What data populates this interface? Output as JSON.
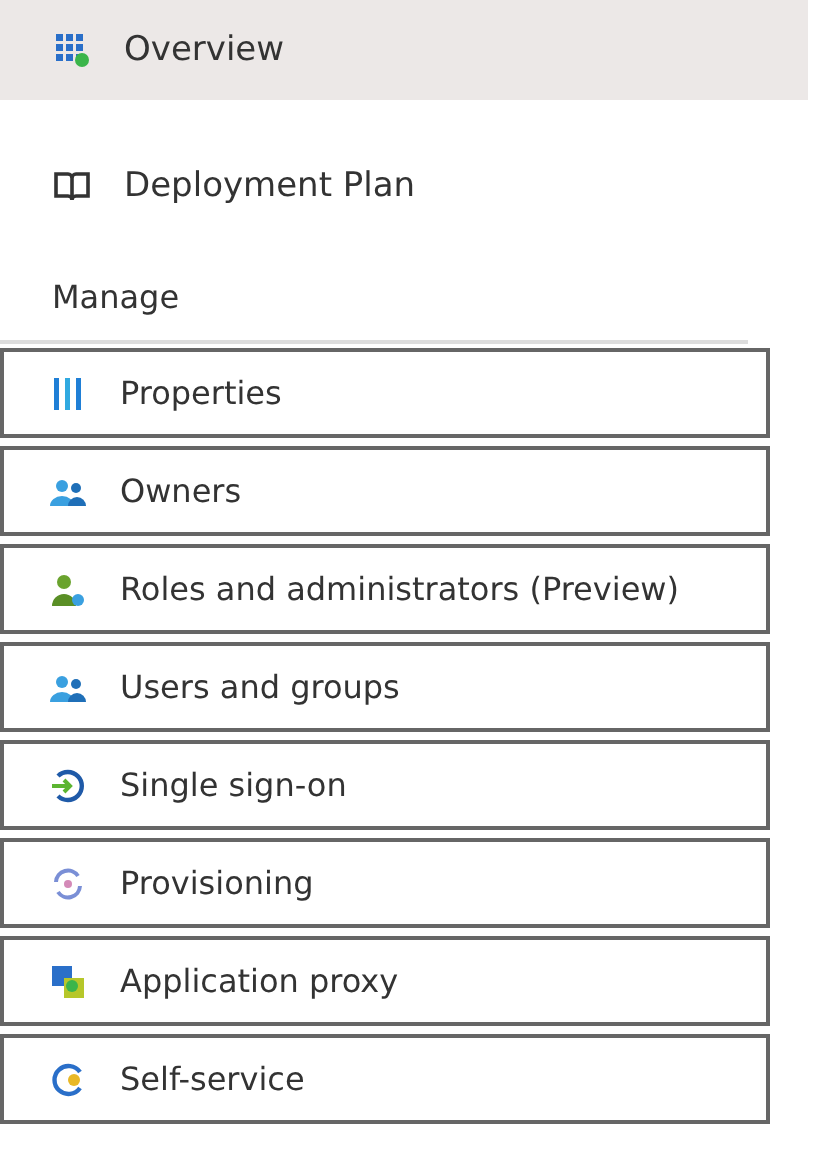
{
  "nav_items": [
    {
      "label": "Overview",
      "kind": "grid",
      "selected": true
    },
    {
      "label": "Deployment Plan",
      "kind": "book",
      "selected": false
    }
  ],
  "section": {
    "title": "Manage",
    "items": [
      {
        "label": "Properties",
        "kind": "bars",
        "selected": false
      },
      {
        "label": "Owners",
        "kind": "people",
        "selected": false
      },
      {
        "label": "Roles and administrators (Preview)",
        "kind": "role",
        "selected": false
      },
      {
        "label": "Users and groups",
        "kind": "people",
        "selected": false
      },
      {
        "label": "Single sign-on",
        "kind": "signin",
        "selected": false
      },
      {
        "label": "Provisioning",
        "kind": "sync",
        "selected": false
      },
      {
        "label": "Application proxy",
        "kind": "proxy",
        "selected": false
      },
      {
        "label": "Self-service",
        "kind": "selfservice",
        "selected": false
      }
    ]
  }
}
